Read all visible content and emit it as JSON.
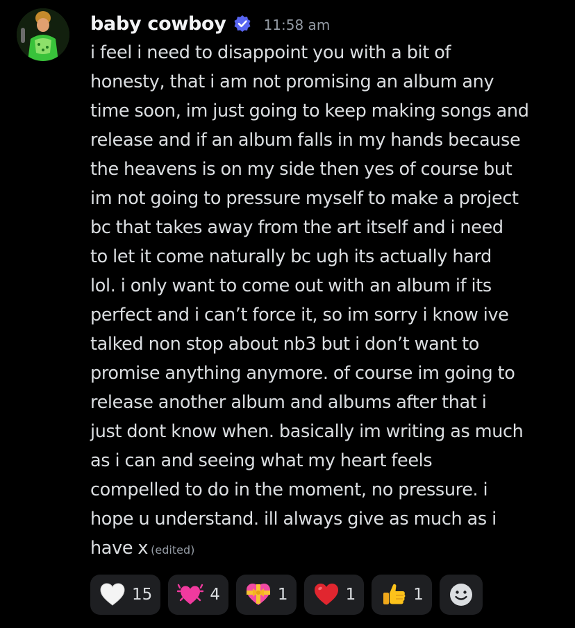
{
  "message": {
    "username": "baby cowboy",
    "timestamp": "11:58 am",
    "verified_badge_icon": "verified-check-icon",
    "lines": [
      "i feel i need to disappoint you with a bit of",
      "honesty, that i am not promising an album any",
      "time soon, im just going to keep making songs and",
      "release and if an album falls in my hands because",
      "the heavens is on my side then yes of course but",
      "im not going to pressure myself to make a project",
      "bc that takes away from the art itself and i need",
      "to let it come naturally bc ugh its actually hard",
      "lol. i only want to come out with an album if its",
      "perfect and i can’t force it, so im sorry i know ive",
      "talked non stop about nb3 but i don’t want to",
      "promise anything anymore. of course im going to",
      "release another album and albums after that i",
      "just dont know when. basically im writing as much",
      "as i can and seeing what my heart feels",
      "compelled to do in the moment, no pressure. i",
      "hope u understand. ill always give as much as i",
      "have x"
    ],
    "edited_label": "(edited)"
  },
  "reactions": [
    {
      "icon": "white-heart-icon",
      "count": "15"
    },
    {
      "icon": "heart-with-sparkles-icon",
      "count": "4"
    },
    {
      "icon": "heart-with-ribbon-icon",
      "count": "1"
    },
    {
      "icon": "red-heart-icon",
      "count": "1"
    },
    {
      "icon": "thumbs-up-icon",
      "count": "1"
    }
  ],
  "add_reaction_icon": "add-reaction-smiley-icon",
  "colors": {
    "background": "#000000",
    "username": "#f2f3f5",
    "text": "#dbdee1",
    "muted": "#949ba4",
    "reaction_bg": "#1e1f22",
    "verified_blue": "#5865f2"
  }
}
